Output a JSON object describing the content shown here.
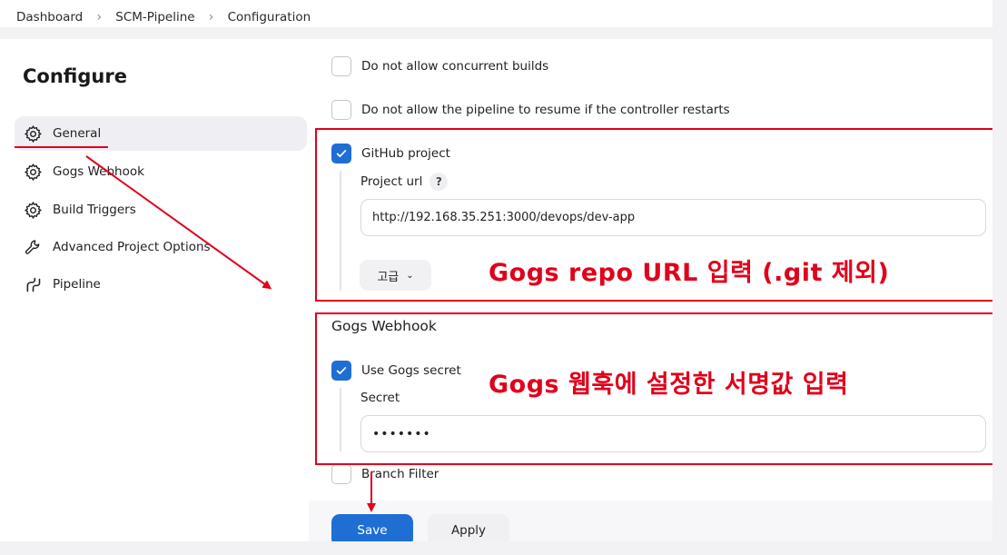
{
  "breadcrumb": [
    "Dashboard",
    "SCM-Pipeline",
    "Configuration"
  ],
  "sidebar": {
    "title": "Configure",
    "items": [
      {
        "label": "General",
        "icon": "gear-icon"
      },
      {
        "label": "Gogs Webhook",
        "icon": "gear-icon"
      },
      {
        "label": "Build Triggers",
        "icon": "gear-icon"
      },
      {
        "label": "Advanced Project Options",
        "icon": "wrench-icon"
      },
      {
        "label": "Pipeline",
        "icon": "pipeline-icon"
      }
    ]
  },
  "general": {
    "no_concurrent": {
      "label": "Do not allow concurrent builds",
      "checked": false
    },
    "no_resume": {
      "label": "Do not allow the pipeline to resume if the controller restarts",
      "checked": false
    },
    "github_project": {
      "label": "GitHub project",
      "checked": true
    },
    "project_url_label": "Project url",
    "project_url_help": "?",
    "project_url_value": "http://192.168.35.251:3000/devops/dev-app",
    "advanced_label": "고급"
  },
  "gogs": {
    "section_title": "Gogs Webhook",
    "use_secret": {
      "label": "Use Gogs secret",
      "checked": true
    },
    "secret_label": "Secret",
    "secret_value": "•••••••",
    "branch_filter": {
      "label": "Branch Filter",
      "checked": false
    }
  },
  "actions": {
    "save_label": "Save",
    "apply_label": "Apply"
  },
  "annotations": {
    "url_note": "Gogs repo URL 입력 (.git 제외)",
    "secret_note": "Gogs 웹훅에 설정한 서명값 입력",
    "color": "#e0001b"
  },
  "colors": {
    "accent": "#1f6ed4",
    "annotation": "#e0001b"
  }
}
